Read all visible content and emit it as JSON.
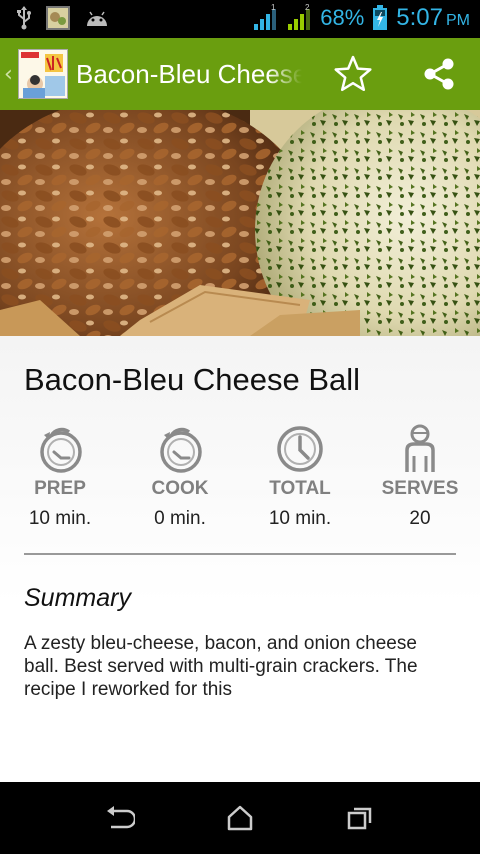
{
  "status_bar": {
    "battery_percent": "68%",
    "time": "5:07",
    "ampm": "PM",
    "icons": [
      "usb-icon",
      "cheese-ball-notification-icon",
      "android-icon",
      "signal-1-icon",
      "signal-2-icon",
      "battery-charging-icon"
    ],
    "accent_color": "#33b5e5"
  },
  "action_bar": {
    "title": "Bacon-Bleu Cheese Ball",
    "color": "#6a9e0f",
    "app_icon_label": "Cheese Balls",
    "actions": [
      "star-icon",
      "share-icon"
    ]
  },
  "recipe": {
    "title": "Bacon-Bleu Cheese Ball",
    "stats": [
      {
        "icon": "timer-icon",
        "label": "PREP",
        "value": "10 min."
      },
      {
        "icon": "timer-icon",
        "label": "COOK",
        "value": "0 min."
      },
      {
        "icon": "clock-icon",
        "label": "TOTAL",
        "value": "10 min."
      },
      {
        "icon": "person-icon",
        "label": "SERVES",
        "value": "20"
      }
    ],
    "summary_heading": "Summary",
    "summary_text": "A zesty bleu-cheese, bacon, and onion cheese ball. Best served with multi-grain crackers. The recipe I reworked for this"
  },
  "nav_bar": {
    "buttons": [
      "back-icon",
      "home-icon",
      "recent-apps-icon"
    ]
  }
}
